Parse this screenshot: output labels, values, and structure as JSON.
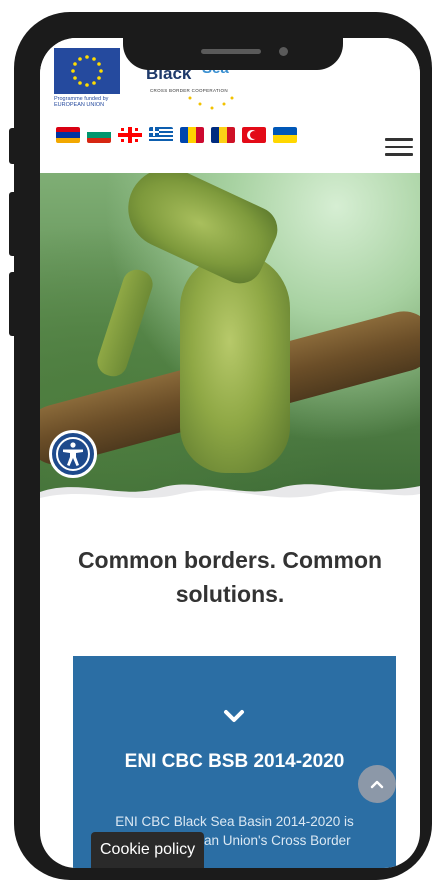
{
  "header": {
    "eu_caption_line1": "Programme funded by",
    "eu_caption_line2": "EUROPEAN UNION",
    "logo_text": "Black",
    "logo_text_accent": "Sea",
    "logo_subtitle": "CROSS BORDER COOPERATION",
    "flags": [
      {
        "name": "Armenia",
        "stripes": [
          "#d90012",
          "#0033a0",
          "#f2a800"
        ],
        "orientation": "horizontal"
      },
      {
        "name": "Bulgaria",
        "stripes": [
          "#ffffff",
          "#00966e",
          "#d62612"
        ],
        "orientation": "horizontal"
      },
      {
        "name": "Georgia",
        "stripes": [
          "#ffffff",
          "#ff0000"
        ],
        "orientation": "cross"
      },
      {
        "name": "Greece",
        "stripes": [
          "#0d5eaf",
          "#ffffff"
        ],
        "orientation": "stripes"
      },
      {
        "name": "Moldova",
        "stripes": [
          "#0046ae",
          "#ffd200",
          "#cc092f"
        ],
        "orientation": "vertical"
      },
      {
        "name": "Romania",
        "stripes": [
          "#002b7f",
          "#fcd116",
          "#ce1126"
        ],
        "orientation": "vertical"
      },
      {
        "name": "Turkey",
        "stripes": [
          "#e30a17"
        ],
        "orientation": "crescent"
      },
      {
        "name": "Ukraine",
        "stripes": [
          "#0057b7",
          "#ffd700"
        ],
        "orientation": "horizontal"
      }
    ],
    "menu_icon": "hamburger-menu-icon"
  },
  "hero": {
    "image": "seahorse underwater photo",
    "accessibility_icon": "accessibility-icon"
  },
  "main": {
    "tagline": "Common borders. Common solutions.",
    "card": {
      "title": "ENI CBC BSB 2014-2020",
      "text": "ENI CBC Black Sea Basin 2014-2020 is part of European Union's Cross Border",
      "chevron_icon": "chevron-down-icon",
      "color": "#2b6ea4"
    }
  },
  "scroll_top_icon": "chevron-up-icon",
  "cookie": {
    "label": "Cookie policy"
  }
}
